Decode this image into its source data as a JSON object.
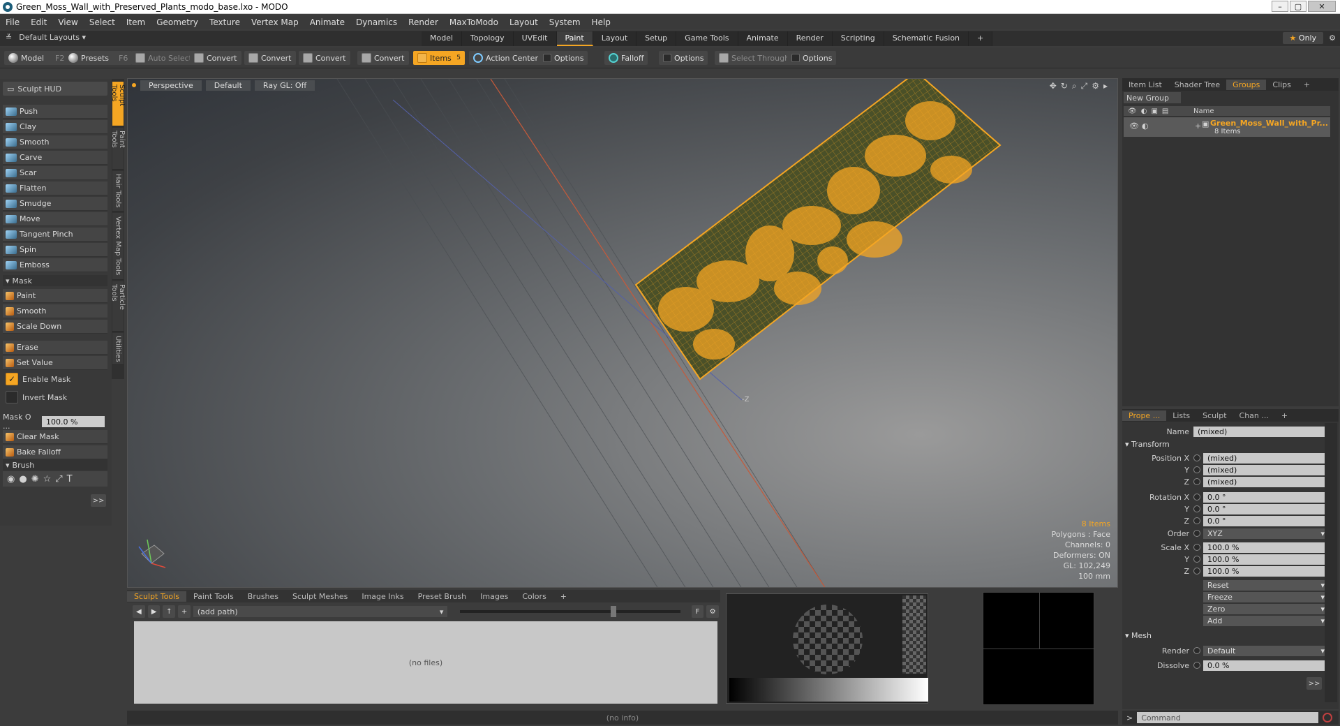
{
  "window": {
    "title": "Green_Moss_Wall_with_Preserved_Plants_modo_base.lxo - MODO"
  },
  "menu": [
    "File",
    "Edit",
    "View",
    "Select",
    "Item",
    "Geometry",
    "Texture",
    "Vertex Map",
    "Animate",
    "Dynamics",
    "Render",
    "MaxToModo",
    "Layout",
    "System",
    "Help"
  ],
  "layout": {
    "default_layouts": "Default Layouts ▾",
    "tabs": [
      "Model",
      "Topology",
      "UVEdit",
      "Paint",
      "Layout",
      "Setup",
      "Game Tools",
      "Animate",
      "Render",
      "Scripting",
      "Schematic Fusion"
    ],
    "active_tab": "Paint",
    "plus": "+",
    "only_label": "Only"
  },
  "toolbar": {
    "model": "Model",
    "model_key": "F2",
    "presets": "Presets",
    "presets_key": "F6",
    "auto_select": "Auto Select",
    "convert1": "Convert",
    "convert2": "Convert",
    "convert3": "Convert",
    "convert4": "Convert",
    "items": "Items",
    "items_key": "5",
    "action_center": "Action Center",
    "options1": "Options",
    "falloff": "Falloff",
    "options2": "Options",
    "select_through": "Select Through",
    "options3": "Options"
  },
  "sculpt_hud": {
    "title": "Sculpt HUD",
    "tools": [
      "Push",
      "Clay",
      "Smooth",
      "Carve",
      "Scar",
      "Flatten",
      "Smudge",
      "Move",
      "Tangent Pinch",
      "Spin",
      "Emboss"
    ],
    "mask_label": "Mask",
    "mask_tools": [
      "Paint",
      "Smooth",
      "Scale Down"
    ],
    "erase": "Erase",
    "set_value": "Set Value",
    "enable_mask": "Enable Mask",
    "invert_mask": "Invert Mask",
    "mask_opacity_label": "Mask O ...",
    "mask_opacity_value": "100.0 %",
    "clear_mask": "Clear Mask",
    "bake_falloff": "Bake Falloff",
    "brush_label": "Brush",
    "more": ">>"
  },
  "vertical_tabs": [
    "Sculpt Tools",
    "Paint Tools",
    "Hair Tools",
    "Vertex Map Tools",
    "Particle Tools",
    "Utilities"
  ],
  "viewport": {
    "view": "Perspective",
    "shading": "Default",
    "raygl": "Ray GL: Off",
    "info": {
      "items": "8 Items",
      "polygons": "Polygons : Face",
      "channels": "Channels: 0",
      "deformers": "Deformers: ON",
      "gl": "GL: 102,249",
      "scale": "100 mm"
    },
    "axis_label": "-Z"
  },
  "bottom_panel": {
    "tabs": [
      "Sculpt Tools",
      "Paint Tools",
      "Brushes",
      "Sculpt Meshes",
      "Image Inks",
      "Preset Brush",
      "Images",
      "Colors",
      "+"
    ],
    "path": "(add path)",
    "no_files": "(no files)",
    "f_btn": "F"
  },
  "status": {
    "info": "(no info)"
  },
  "groups_panel": {
    "tabs": [
      "Item List",
      "Shader Tree",
      "Groups",
      "Clips",
      "+"
    ],
    "active_tab": "Groups",
    "new_group": "New Group",
    "name_col": "Name",
    "group_name": "Green_Moss_Wall_with_Pr...",
    "group_count": "8 Items"
  },
  "properties": {
    "tabs": [
      "Prope ...",
      "Lists",
      "Sculpt",
      "Chan ...",
      "+"
    ],
    "name_label": "Name",
    "name_value": "(mixed)",
    "transform": "Transform",
    "position_label": "Position X",
    "pos_x": "(mixed)",
    "pos_y": "(mixed)",
    "pos_z": "(mixed)",
    "rotation_label": "Rotation X",
    "rot_x": "0.0 °",
    "rot_y": "0.0 °",
    "rot_z": "0.0 °",
    "order_label": "Order",
    "order_value": "XYZ",
    "scale_label": "Scale X",
    "scale_x": "100.0 %",
    "scale_y": "100.0 %",
    "scale_z": "100.0 %",
    "y": "Y",
    "z": "Z",
    "reset": "Reset",
    "freeze": "Freeze",
    "zero": "Zero",
    "add": "Add",
    "mesh": "Mesh",
    "render_label": "Render",
    "render_value": "Default",
    "dissolve_label": "Dissolve",
    "dissolve_value": "0.0 %",
    "more": ">>"
  },
  "command": {
    "placeholder": "Command",
    "prompt": ">"
  },
  "colors": {
    "accent": "#f5a623",
    "mesh": "#f5a623"
  }
}
